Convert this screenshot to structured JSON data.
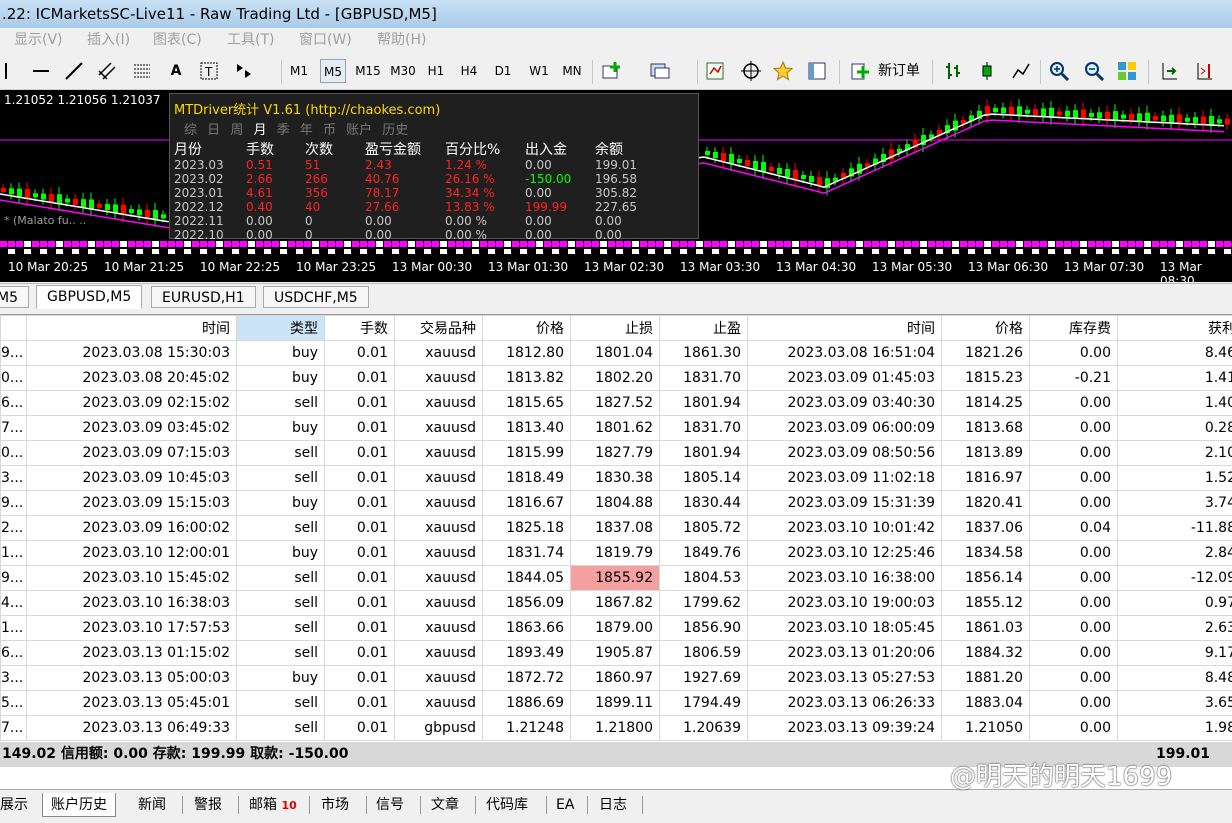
{
  "window": {
    "title": ".22: ICMarketsSC-Live11 - Raw Trading Ltd - [GBPUSD,M5]"
  },
  "menu": [
    "显示(V)",
    "插入(I)",
    "图表(C)",
    "工具(T)",
    "窗口(W)",
    "帮助(H)"
  ],
  "toolbar": {
    "timeframes": [
      "M1",
      "M5",
      "M15",
      "M30",
      "H1",
      "H4",
      "D1",
      "W1",
      "MN"
    ],
    "active_timeframe": "M5",
    "new_order_label": "新订单"
  },
  "chart": {
    "price_readout": "1.21052 1.21056 1.21037",
    "time_labels": [
      "10 Mar 20:25",
      "10 Mar 21:25",
      "10 Mar 22:25",
      "10 Mar 23:25",
      "13 Mar 00:30",
      "13 Mar 01:30",
      "13 Mar 02:30",
      "13 Mar 03:30",
      "13 Mar 04:30",
      "13 Mar 05:30",
      "13 Mar 06:30",
      "13 Mar 07:30",
      "13 Mar 08:30"
    ],
    "indicator_label": "* (Malato fu.. .."
  },
  "stats_panel": {
    "title": "MTDriver统计 V1.61 (http://chaokes.com)",
    "tabs": [
      "综",
      "日",
      "周",
      "月",
      "季",
      "年",
      "币",
      "账户",
      "历史"
    ],
    "selected_tab": "月",
    "headers": [
      "月份",
      "手数",
      "次数",
      "盈亏金额",
      "百分比%",
      "出入金",
      "余额"
    ],
    "rows": [
      [
        "2023.03",
        "0.51",
        "51",
        "2.43",
        "1.24 %",
        "0.00",
        "199.01"
      ],
      [
        "2023.02",
        "2.66",
        "266",
        "40.76",
        "26.16 %",
        "-150.00",
        "196.58"
      ],
      [
        "2023.01",
        "4.61",
        "356",
        "78.17",
        "34.34 %",
        "0.00",
        "305.82"
      ],
      [
        "2022.12",
        "0.40",
        "40",
        "27.66",
        "13.83 %",
        "199.99",
        "227.65"
      ],
      [
        "2022.11",
        "0.00",
        "0",
        "0.00",
        "0.00 %",
        "0.00",
        "0.00"
      ],
      [
        "2022.10",
        "0.00",
        "0",
        "0.00",
        "0.00 %",
        "0.00",
        "0.00"
      ]
    ]
  },
  "chart_tabs": [
    "M5",
    "GBPUSD,M5",
    "EURUSD,H1",
    "USDCHF,M5"
  ],
  "selected_chart_tab": "GBPUSD,M5",
  "history_table": {
    "headers": [
      "",
      "时间",
      "类型",
      "手数",
      "交易品种",
      "价格",
      "止损",
      "止盈",
      "时间",
      "价格",
      "库存费",
      "获利"
    ],
    "rows": [
      [
        "9...",
        "2023.03.08 15:30:03",
        "buy",
        "0.01",
        "xauusd",
        "1812.80",
        "1801.04",
        "1861.30",
        "2023.03.08 16:51:04",
        "1821.26",
        "0.00",
        "8.46"
      ],
      [
        "0...",
        "2023.03.08 20:45:02",
        "buy",
        "0.01",
        "xauusd",
        "1813.82",
        "1802.20",
        "1831.70",
        "2023.03.09 01:45:03",
        "1815.23",
        "-0.21",
        "1.41"
      ],
      [
        "6...",
        "2023.03.09 02:15:02",
        "sell",
        "0.01",
        "xauusd",
        "1815.65",
        "1827.52",
        "1801.94",
        "2023.03.09 03:40:30",
        "1814.25",
        "0.00",
        "1.40"
      ],
      [
        "7...",
        "2023.03.09 03:45:02",
        "buy",
        "0.01",
        "xauusd",
        "1813.40",
        "1801.62",
        "1831.70",
        "2023.03.09 06:00:09",
        "1813.68",
        "0.00",
        "0.28"
      ],
      [
        "0...",
        "2023.03.09 07:15:03",
        "sell",
        "0.01",
        "xauusd",
        "1815.99",
        "1827.79",
        "1801.94",
        "2023.03.09 08:50:56",
        "1813.89",
        "0.00",
        "2.10"
      ],
      [
        "3...",
        "2023.03.09 10:45:03",
        "sell",
        "0.01",
        "xauusd",
        "1818.49",
        "1830.38",
        "1805.14",
        "2023.03.09 11:02:18",
        "1816.97",
        "0.00",
        "1.52"
      ],
      [
        "9...",
        "2023.03.09 15:15:03",
        "buy",
        "0.01",
        "xauusd",
        "1816.67",
        "1804.88",
        "1830.44",
        "2023.03.09 15:31:39",
        "1820.41",
        "0.00",
        "3.74"
      ],
      [
        "2...",
        "2023.03.09 16:00:02",
        "sell",
        "0.01",
        "xauusd",
        "1825.18",
        "1837.08",
        "1805.72",
        "2023.03.10 10:01:42",
        "1837.06",
        "0.04",
        "-11.88"
      ],
      [
        "1...",
        "2023.03.10 12:00:01",
        "buy",
        "0.01",
        "xauusd",
        "1831.74",
        "1819.79",
        "1849.76",
        "2023.03.10 12:25:46",
        "1834.58",
        "0.00",
        "2.84"
      ],
      [
        "9...",
        "2023.03.10 15:45:02",
        "sell",
        "0.01",
        "xauusd",
        "1844.05",
        "1855.92",
        "1804.53",
        "2023.03.10 16:38:00",
        "1856.14",
        "0.00",
        "-12.09"
      ],
      [
        "4...",
        "2023.03.10 16:38:03",
        "sell",
        "0.01",
        "xauusd",
        "1856.09",
        "1867.82",
        "1799.62",
        "2023.03.10 19:00:03",
        "1855.12",
        "0.00",
        "0.97"
      ],
      [
        "1...",
        "2023.03.10 17:57:53",
        "sell",
        "0.01",
        "xauusd",
        "1863.66",
        "1879.00",
        "1856.90",
        "2023.03.10 18:05:45",
        "1861.03",
        "0.00",
        "2.63"
      ],
      [
        "6...",
        "2023.03.13 01:15:02",
        "sell",
        "0.01",
        "xauusd",
        "1893.49",
        "1905.87",
        "1806.59",
        "2023.03.13 01:20:06",
        "1884.32",
        "0.00",
        "9.17"
      ],
      [
        "3...",
        "2023.03.13 05:00:03",
        "buy",
        "0.01",
        "xauusd",
        "1872.72",
        "1860.97",
        "1927.69",
        "2023.03.13 05:27:53",
        "1881.20",
        "0.00",
        "8.48"
      ],
      [
        "5...",
        "2023.03.13 05:45:01",
        "sell",
        "0.01",
        "xauusd",
        "1886.69",
        "1899.11",
        "1794.49",
        "2023.03.13 06:26:33",
        "1883.04",
        "0.00",
        "3.65"
      ],
      [
        "7...",
        "2023.03.13 06:49:33",
        "sell",
        "0.01",
        "gbpusd",
        "1.21248",
        "1.21800",
        "1.20639",
        "2023.03.13 09:39:24",
        "1.21050",
        "0.00",
        "1.98"
      ]
    ],
    "highlight_cell": {
      "row": 9,
      "col": 6
    }
  },
  "summary": {
    "left": "149.02  信用额: 0.00  存款: 199.99  取款: -150.00",
    "right": "199.01"
  },
  "bottom_tabs": [
    "展示",
    "账户历史",
    "新闻",
    "警报",
    "邮箱",
    "市场",
    "信号",
    "文章",
    "代码库",
    "EA",
    "日志"
  ],
  "selected_bottom_tab": "账户历史",
  "mail_badge": "10",
  "watermark": "@明天的明天1699",
  "colors": {
    "chart_bg": "#000000",
    "bull": "#00ff00",
    "bear": "#ff0000",
    "ma_fast": "#ffffff",
    "ma_slow": "#ff00ff",
    "highlight": "#f4a0a0",
    "panel_title": "#ffd700",
    "loss_red": "#ff2020",
    "gain_green": "#00ff00"
  }
}
